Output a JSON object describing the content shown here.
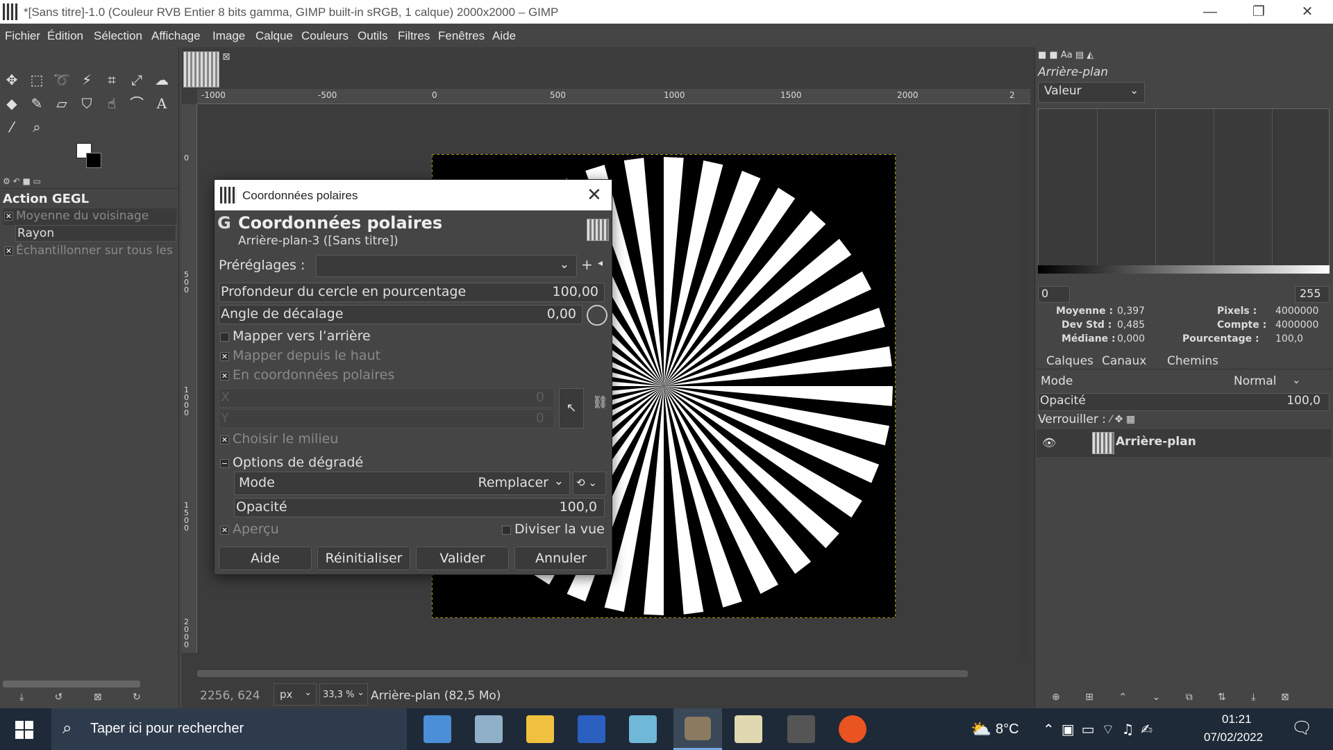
{
  "window": {
    "title": "*[Sans titre]-1.0 (Couleur RVB Entier 8 bits gamma, GIMP built-in sRGB, 1 calque) 2000x2000 – GIMP",
    "controls": [
      "—",
      "❐",
      "✕"
    ]
  },
  "menu": [
    "Fichier",
    "Édition",
    "Sélection",
    "Affichage",
    "Image",
    "Calque",
    "Couleurs",
    "Outils",
    "Filtres",
    "Fenêtres",
    "Aide"
  ],
  "toolbox": {
    "options_title": "Action GEGL",
    "options": [
      {
        "label": "Moyenne du voisinage",
        "checked": true
      },
      {
        "label": "Rayon",
        "checked": false
      },
      {
        "label": "Échantillonner sur tous les",
        "checked": true
      }
    ]
  },
  "ruler": {
    "h_labels": [
      "-1000",
      "-500",
      "0",
      "500",
      "1000",
      "1500",
      "2000",
      "2"
    ],
    "v_labels": [
      "0",
      "5\n0\n0",
      "1\n0\n0\n0",
      "1\n5\n0\n0",
      "2\n0\n0\n0"
    ]
  },
  "status": {
    "coords": "2256, 624",
    "unit": "px",
    "zoom": "33,3 %",
    "layer_info": "Arrière-plan (82,5 Mo)"
  },
  "dialog": {
    "window_title": "Coordonnées polaires",
    "header_title": "Coordonnées polaires",
    "header_sub": "Arrière-plan-3 ([Sans titre])",
    "presets_label": "Préréglages :",
    "presets_value": "",
    "depth_label": "Profondeur du cercle en pourcentage",
    "depth_value": "100,00",
    "angle_label": "Angle de décalage",
    "angle_value": "0,00",
    "map_back": "Mapper vers l’arrière",
    "map_top": "Mapper depuis le haut",
    "to_polar": "En coordonnées polaires",
    "x_label": "X",
    "x_value": "0",
    "y_label": "Y",
    "y_value": "0",
    "choose_middle": "Choisir le milieu",
    "blend_options": "Options de dégradé",
    "mode_label": "Mode",
    "mode_value": "Remplacer",
    "opacity_label": "Opacité",
    "opacity_value": "100,0",
    "preview": "Aperçu",
    "split_view": "Diviser la vue",
    "buttons": {
      "help": "Aide",
      "reset": "Réinitialiser",
      "ok": "Valider",
      "cancel": "Annuler"
    }
  },
  "histogram": {
    "layer": "Arrière-plan",
    "channel": "Valeur",
    "range_min": "0",
    "range_max": "255",
    "stats": {
      "mean_label": "Moyenne :",
      "mean": "0,397",
      "std_label": "Dev Std :",
      "std": "0,485",
      "median_label": "Médiane :",
      "median": "0,000",
      "pixels_label": "Pixels :",
      "pixels": "4000000",
      "count_label": "Compte :",
      "count": "4000000",
      "percent_label": "Pourcentage :",
      "percent": "100,0"
    }
  },
  "layers": {
    "tabs": [
      "Calques",
      "Canaux",
      "Chemins"
    ],
    "mode_label": "Mode",
    "mode_value": "Normal",
    "opacity_label": "Opacité",
    "opacity_value": "100,0",
    "lock_label": "Verrouiller :",
    "items": [
      {
        "name": "Arrière-plan",
        "visible": true
      }
    ]
  },
  "taskbar": {
    "search_placeholder": "Taper ici pour rechercher",
    "weather": "8°C",
    "time": "01:21",
    "date": "07/02/2022"
  },
  "colors": {
    "bg": "#454545",
    "canvas": "#3c3c3c",
    "taskbar": "#1f2a38"
  }
}
